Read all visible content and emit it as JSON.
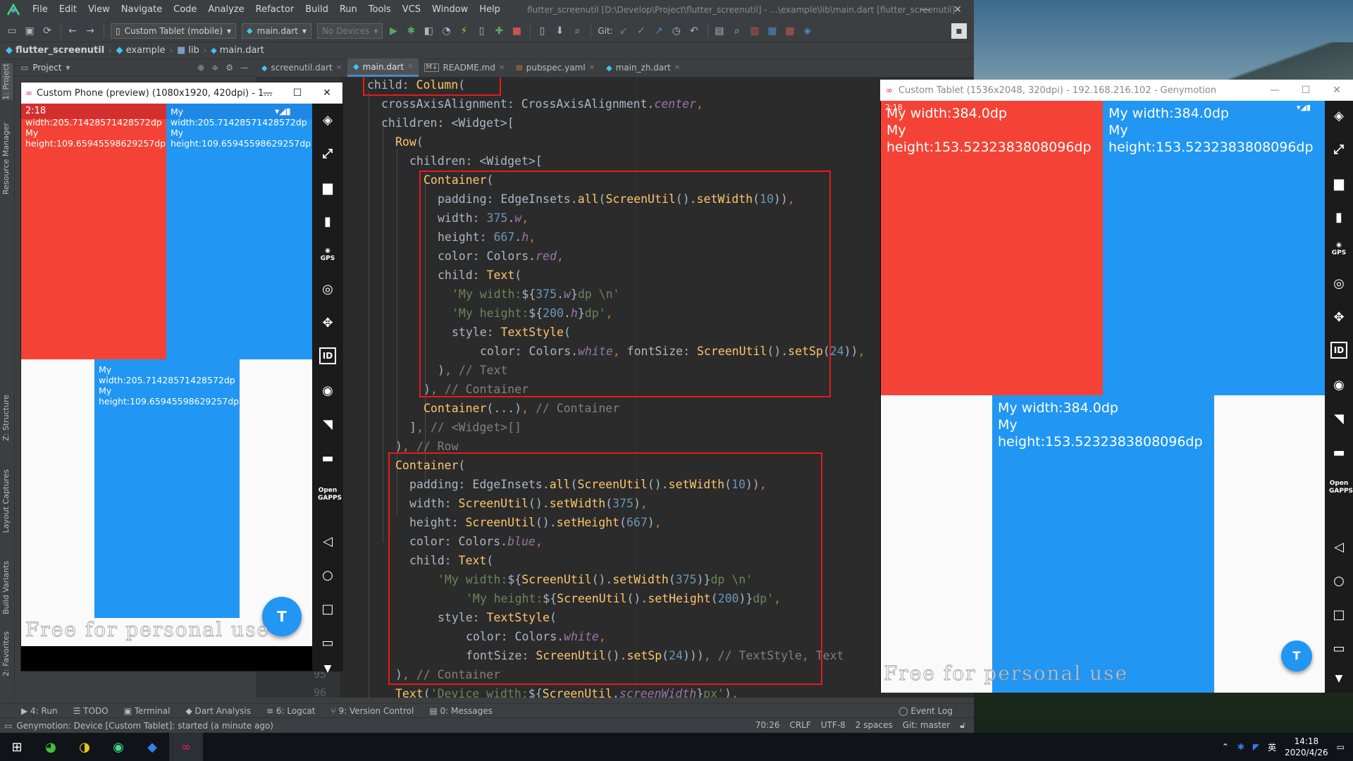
{
  "ide": {
    "menu": [
      "File",
      "Edit",
      "View",
      "Navigate",
      "Code",
      "Analyze",
      "Refactor",
      "Build",
      "Run",
      "Tools",
      "VCS",
      "Window",
      "Help"
    ],
    "window_title": "flutter_screenutil [D:\\Develop\\Project\\flutter_screenutil] - ...\\example\\lib\\main.dart [flutter_screenutil]",
    "toolbar": {
      "device_combo": "Custom Tablet (mobile)",
      "config_combo": "main.dart",
      "devices_combo": "No Devices",
      "git_label": "Git:"
    },
    "breadcrumbs": [
      "flutter_screenutil",
      "example",
      "lib",
      "main.dart"
    ],
    "project_label": "Project",
    "tabs": [
      "screenutil.dart",
      "main.dart",
      "README.md",
      "pubspec.yaml",
      "main_zh.dart"
    ],
    "side_tabs": [
      "1: Project",
      "Resource Manager",
      "Z: Structure",
      "Layout Captures",
      "Build Variants",
      "2: Favorites"
    ],
    "line_numbers": [
      "95",
      "96"
    ],
    "bottom_tools": [
      "4: Run",
      "TODO",
      "Terminal",
      "Dart Analysis",
      "6: Logcat",
      "9: Version Control",
      "0: Messages",
      "Event Log"
    ],
    "status_message": "Genymotion: Device [Custom Tablet]: started (a minute ago)",
    "status_right": [
      "70:26",
      "CRLF",
      "UTF-8",
      "2 spaces",
      "Git: master"
    ]
  },
  "phone": {
    "title": "Custom Phone (preview) (1080x1920, 420dpi) - 1...",
    "time": "2:18",
    "block_width": "width:205.71428571428572dp",
    "block_height": "height:109.65945598629257dp",
    "my": "My",
    "fab": "T",
    "watermark": "Free for personal use"
  },
  "tablet": {
    "title": "Custom Tablet (1536x2048, 320dpi) - 192.168.216.102 - Genymotion",
    "time": "2:18",
    "block_width": "My width:384.0dp",
    "my": "My",
    "block_height": "height:153.5232383808096dp",
    "fab": "T",
    "watermark": "Free for personal use"
  },
  "taskbar": {
    "ime": "英",
    "time": "14:18",
    "date": "2020/4/26"
  },
  "colors": {
    "red": "#f44336",
    "blue": "#2196f3",
    "highlight": "#e41b1b"
  }
}
